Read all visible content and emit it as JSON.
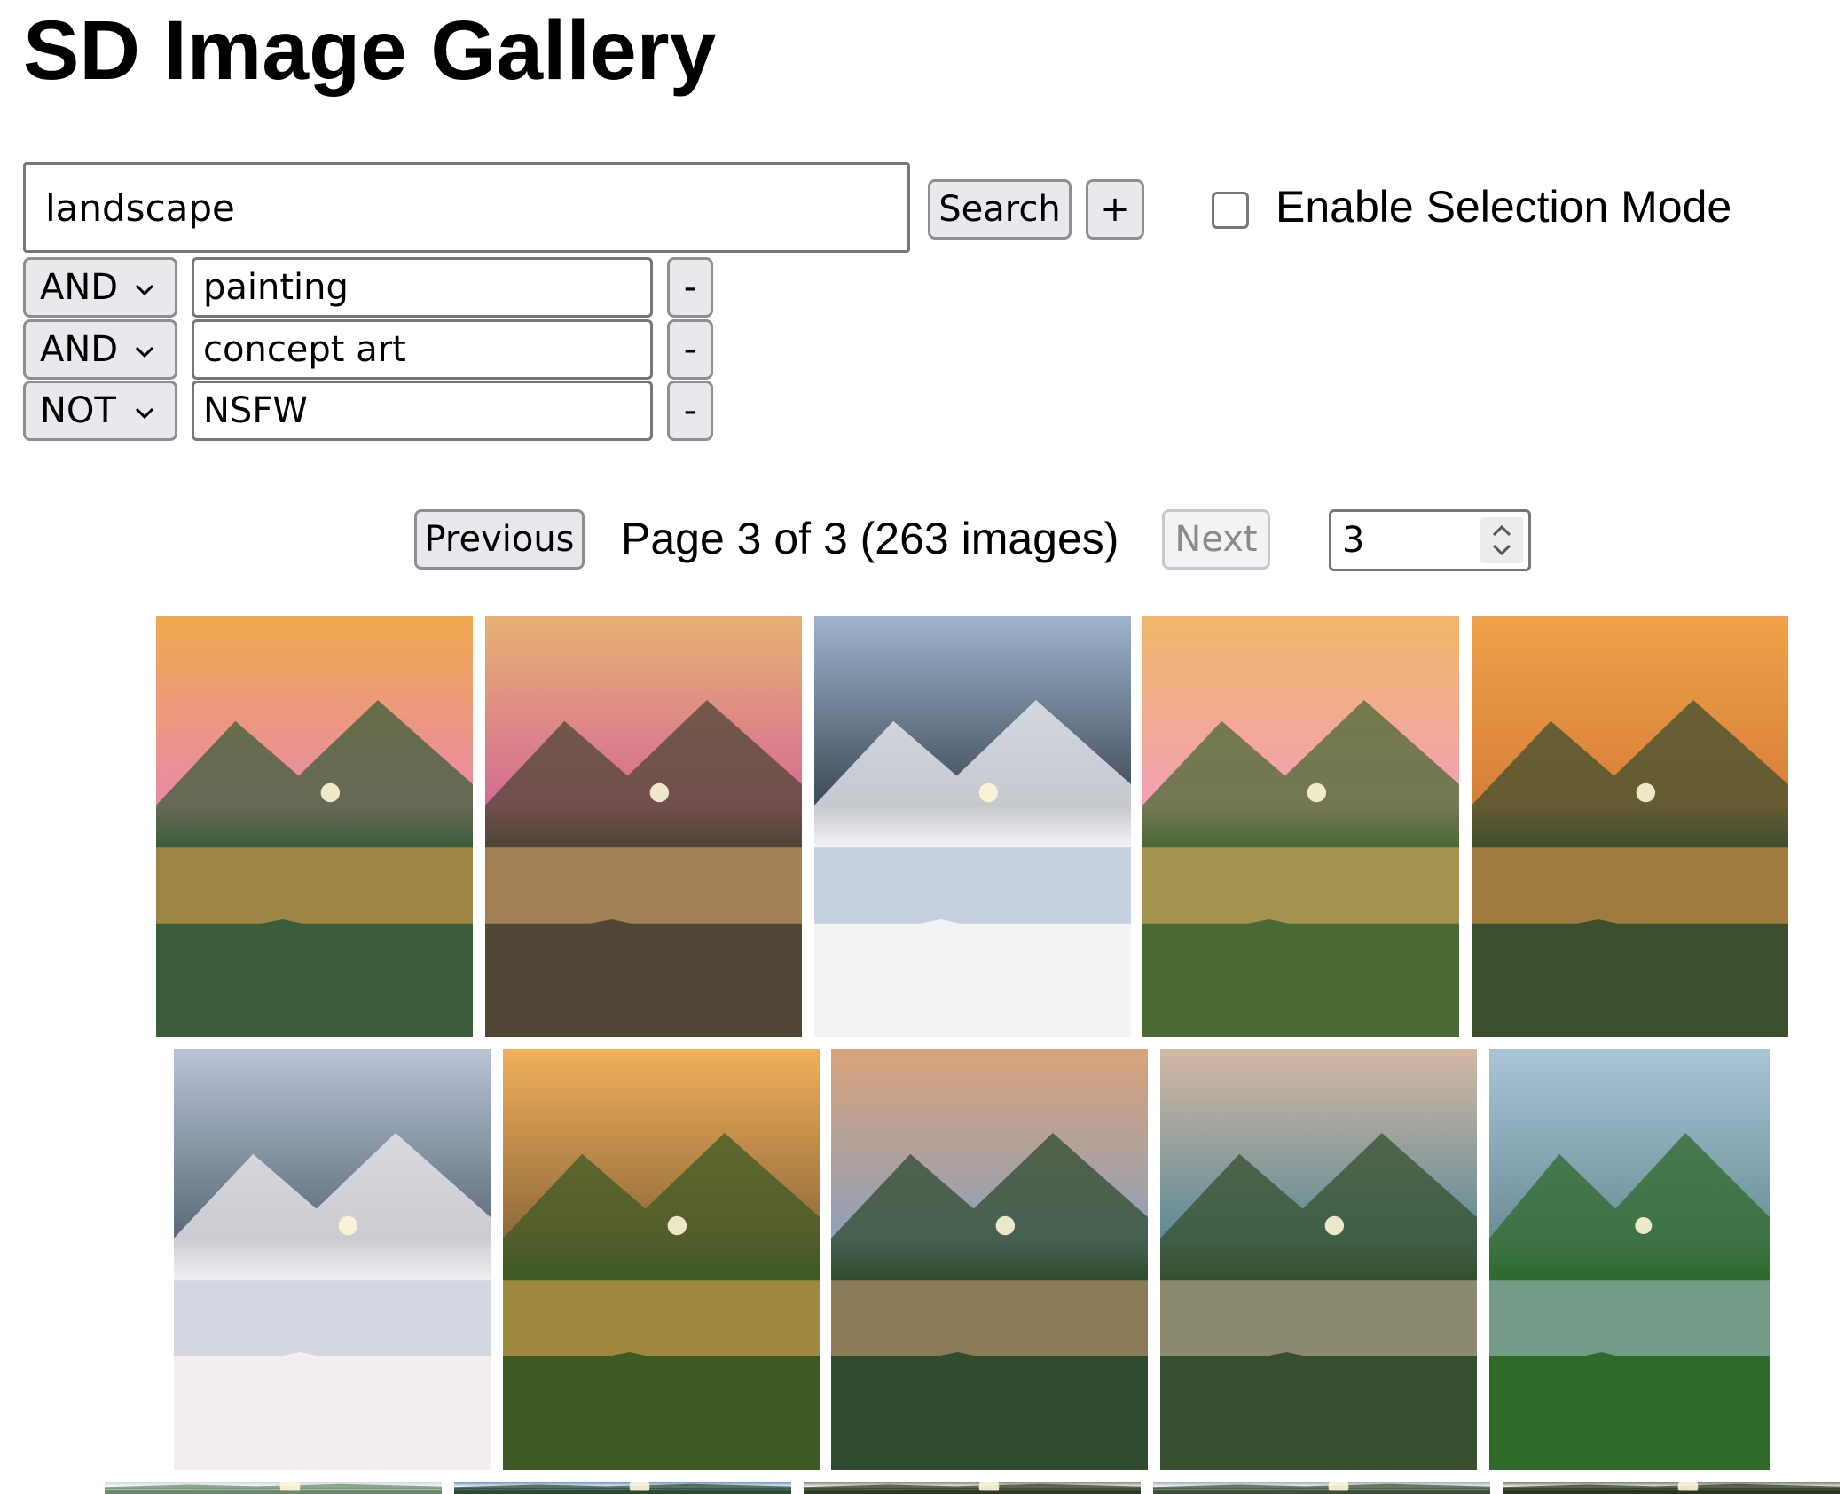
{
  "app": {
    "title": "SD Image Gallery"
  },
  "search": {
    "query": "landscape",
    "search_label": "Search",
    "add_label": "+",
    "selection_mode_label": "Enable Selection Mode",
    "selection_mode_checked": false
  },
  "terms": [
    {
      "operator": "AND",
      "value": "painting",
      "remove_label": "-"
    },
    {
      "operator": "AND",
      "value": "concept art",
      "remove_label": "-"
    },
    {
      "operator": "NOT",
      "value": "NSFW",
      "remove_label": "-"
    }
  ],
  "pagination": {
    "previous_label": "Previous",
    "status": "Page 3 of 3 (263 images)",
    "next_label": "Next",
    "next_disabled": true,
    "page_input_value": "3"
  },
  "gallery": {
    "images": [
      {
        "name": "mountain-lake-sunset-flowers",
        "palette": [
          "#f0a94e",
          "#3b5d3a",
          "#e88aa8"
        ]
      },
      {
        "name": "cherry-tree-sunset",
        "palette": [
          "#e7b271",
          "#4f4636",
          "#d56a95"
        ]
      },
      {
        "name": "snowy-mountain-river",
        "palette": [
          "#9fb4cf",
          "#f3f3f6",
          "#3e4a56"
        ]
      },
      {
        "name": "valley-lake-sunrise-flowers",
        "palette": [
          "#f1b767",
          "#4a6a34",
          "#f3a0b6"
        ]
      },
      {
        "name": "golden-sky-mountain-lake",
        "palette": [
          "#f0a14a",
          "#3e4f2f",
          "#d77f39"
        ]
      },
      {
        "name": "winter-forest-lake",
        "palette": [
          "#b9c4d6",
          "#f2eef0",
          "#5a6a78"
        ]
      },
      {
        "name": "tree-sunset-lake",
        "palette": [
          "#f1b05a",
          "#3d5a25",
          "#8f6a3a"
        ]
      },
      {
        "name": "mountain-lake-dusk",
        "palette": [
          "#d9a37b",
          "#2f4c2f",
          "#8fa0b8"
        ]
      },
      {
        "name": "canyon-river-sunset",
        "palette": [
          "#d3b9a3",
          "#36502f",
          "#5d8a96"
        ]
      },
      {
        "name": "green-peaks-lake",
        "palette": [
          "#a9c4d6",
          "#2f6a2b",
          "#6a8f98"
        ]
      },
      {
        "name": "partial-row-3-1",
        "palette": [
          "#c6d3dd",
          "#6b8a6a",
          "#ffffff"
        ]
      },
      {
        "name": "partial-row-3-2",
        "palette": [
          "#4f86c0",
          "#2d4a2e",
          "#ffffff"
        ]
      },
      {
        "name": "partial-row-3-3",
        "palette": [
          "#6c7a5e",
          "#2d3a26",
          "#ffffff"
        ]
      },
      {
        "name": "partial-row-3-4",
        "palette": [
          "#8ea0ae",
          "#3e5036",
          "#ffffff"
        ]
      },
      {
        "name": "partial-row-3-5",
        "palette": [
          "#5d6b4f",
          "#2a3522",
          "#ffffff"
        ]
      }
    ]
  }
}
